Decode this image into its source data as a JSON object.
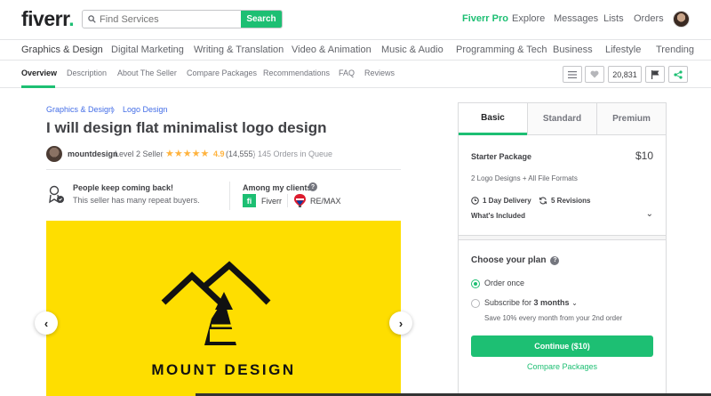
{
  "header": {
    "logo": "fiverr",
    "logo_dot": ".",
    "search_placeholder": "Find Services",
    "search_button": "Search",
    "nav": {
      "pro": "Fiverr Pro",
      "explore": "Explore",
      "messages": "Messages",
      "lists": "Lists",
      "orders": "Orders"
    }
  },
  "categories": [
    "Graphics & Design",
    "Digital Marketing",
    "Writing & Translation",
    "Video & Animation",
    "Music & Audio",
    "Programming & Tech",
    "Business",
    "Lifestyle",
    "Trending"
  ],
  "subnav": {
    "items": [
      "Overview",
      "Description",
      "About The Seller",
      "Compare Packages",
      "Recommendations",
      "FAQ",
      "Reviews"
    ],
    "likes_count": "20,831"
  },
  "gig": {
    "breadcrumb": [
      "Graphics & Design",
      "Logo Design"
    ],
    "breadcrumb_sep": "〉",
    "title": "I will design flat minimalist logo design",
    "seller_name": "mountdesign",
    "seller_level": "Level 2 Seller",
    "rating": "4.9",
    "reviews": "(14,555)",
    "queue": "145 Orders in Queue",
    "repeat_title": "People keep coming back!",
    "repeat_text": "This seller has many repeat buyers.",
    "clients_title": "Among my clients",
    "clients": [
      "Fiverr",
      "RE/MAX"
    ],
    "hero_text": "MOUNT DESIGN"
  },
  "panel": {
    "tabs": [
      "Basic",
      "Standard",
      "Premium"
    ],
    "package_name": "Starter Package",
    "price": "$10",
    "description": "2 Logo Designs + All File Formats",
    "delivery": "1 Day Delivery",
    "revisions": "5 Revisions",
    "included": "What's Included",
    "plan_title": "Choose your plan",
    "option_once": "Order once",
    "option_sub_prefix": "Subscribe for",
    "option_sub_value": "3 months",
    "save_note": "Save 10% every month from your 2nd order",
    "continue": "Continue ($10)",
    "compare": "Compare Packages"
  },
  "colors": {
    "brand_green": "#1dbf73",
    "hero_yellow": "#fede00",
    "link_blue": "#446ee7",
    "star": "#ffb33e"
  }
}
